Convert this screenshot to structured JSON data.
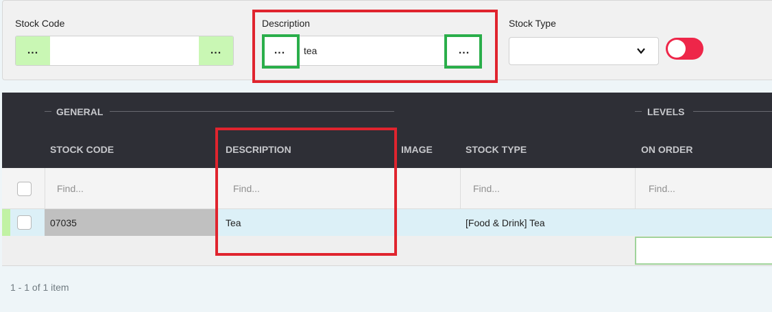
{
  "filters": {
    "stock_code": {
      "label": "Stock Code",
      "left_button": "...",
      "right_button": "...",
      "value": ""
    },
    "description": {
      "label": "Description",
      "left_button": "...",
      "right_button": "...",
      "value": "tea"
    },
    "stock_type": {
      "label": "Stock Type",
      "selected": ""
    },
    "toggle": {
      "state": "off"
    }
  },
  "grid": {
    "groups": [
      "GENERAL",
      "LEVELS"
    ],
    "columns": [
      "STOCK CODE",
      "DESCRIPTION",
      "IMAGE",
      "STOCK TYPE",
      "ON ORDER"
    ],
    "filter_placeholders": [
      "Find...",
      "Find...",
      "Find...",
      "Find..."
    ],
    "rows": [
      {
        "stock_code": "07035",
        "description": "Tea",
        "image": "",
        "stock_type": "[Food & Drink] Tea",
        "on_order": ""
      }
    ]
  },
  "pager": {
    "summary": "1 - 1 of 1 item"
  },
  "colors": {
    "accent_green": "#c9f7b4",
    "toggle_red": "#ee2649",
    "header_dark": "#2e2f36",
    "highlight_red": "#e0242e",
    "highlight_green": "#2aae4a"
  }
}
